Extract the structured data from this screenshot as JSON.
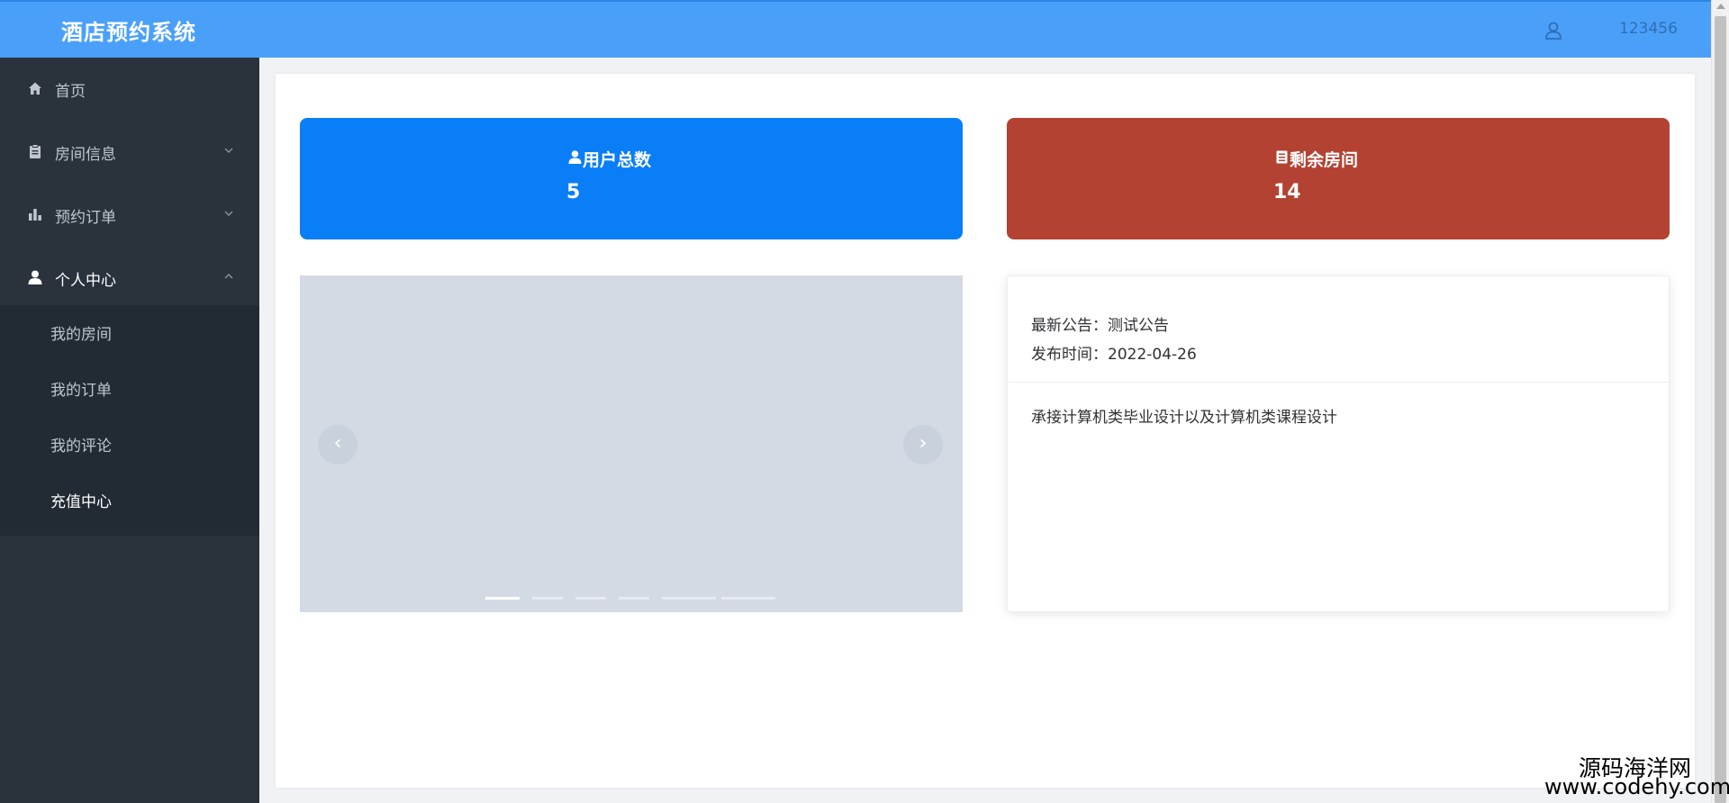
{
  "header": {
    "app_title": "酒店预约系统",
    "username": "123456"
  },
  "sidebar": {
    "items": [
      {
        "label": "首页",
        "icon": "home-icon"
      },
      {
        "label": "房间信息",
        "icon": "clipboard-icon",
        "expanded": false
      },
      {
        "label": "预约订单",
        "icon": "bar-chart-icon",
        "expanded": false
      },
      {
        "label": "个人中心",
        "icon": "user-icon",
        "expanded": true
      }
    ],
    "submenu": [
      {
        "label": "我的房间"
      },
      {
        "label": "我的订单"
      },
      {
        "label": "我的评论"
      },
      {
        "label": "充值中心",
        "active": true
      }
    ]
  },
  "stats": {
    "users": {
      "label": "用户总数",
      "value": "5",
      "color": "#0a7ef6"
    },
    "rooms": {
      "label": "剩余房间",
      "value": "14",
      "color": "#b34233"
    }
  },
  "carousel": {
    "prev_glyph": "‹",
    "next_glyph": "›",
    "indicator_count": 6,
    "active_index": 0
  },
  "notice": {
    "title_line": "最新公告：测试公告",
    "date_line": "发布时间：2022-04-26",
    "content": "承接计算机类毕业设计以及计算机类课程设计"
  },
  "watermark": {
    "name": "源码海洋网",
    "url": "www.codehy.com"
  },
  "colors": {
    "header": "#4aa0f9",
    "sidebar": "#2a323c",
    "accent_blue": "#0a7ef6",
    "accent_red": "#b34233"
  }
}
